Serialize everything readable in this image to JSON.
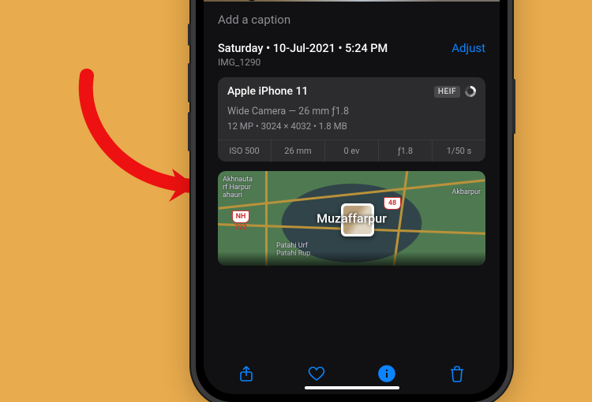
{
  "caption_placeholder": "Add a caption",
  "datetime": {
    "line": "Saturday • 10-Jul-2021 • 5:24 PM",
    "filename": "IMG_1290",
    "adjust_label": "Adjust"
  },
  "metadata": {
    "device": "Apple iPhone 11",
    "format_badge": "HEIF",
    "lens": "Wide Camera — 26 mm ƒ1.8",
    "specs": "12 MP • 3024 × 4032 • 1.8 MB",
    "exif": {
      "iso": "ISO 500",
      "focal": "26 mm",
      "ev": "0 ev",
      "aperture": "ƒ1.8",
      "shutter": "1/50 s"
    }
  },
  "map": {
    "city": "Muzaffarpur",
    "labels": {
      "tl": "Akhnauta\nrf Harpur\nahauri",
      "tr": "Akbarpur",
      "bl": "Patahi Urf\nPatahi Rup"
    },
    "route1": "NH\n722",
    "route2": "48"
  },
  "toolbar": {
    "share": "Share",
    "favorite": "Favorite",
    "info": "Info",
    "delete": "Delete"
  }
}
